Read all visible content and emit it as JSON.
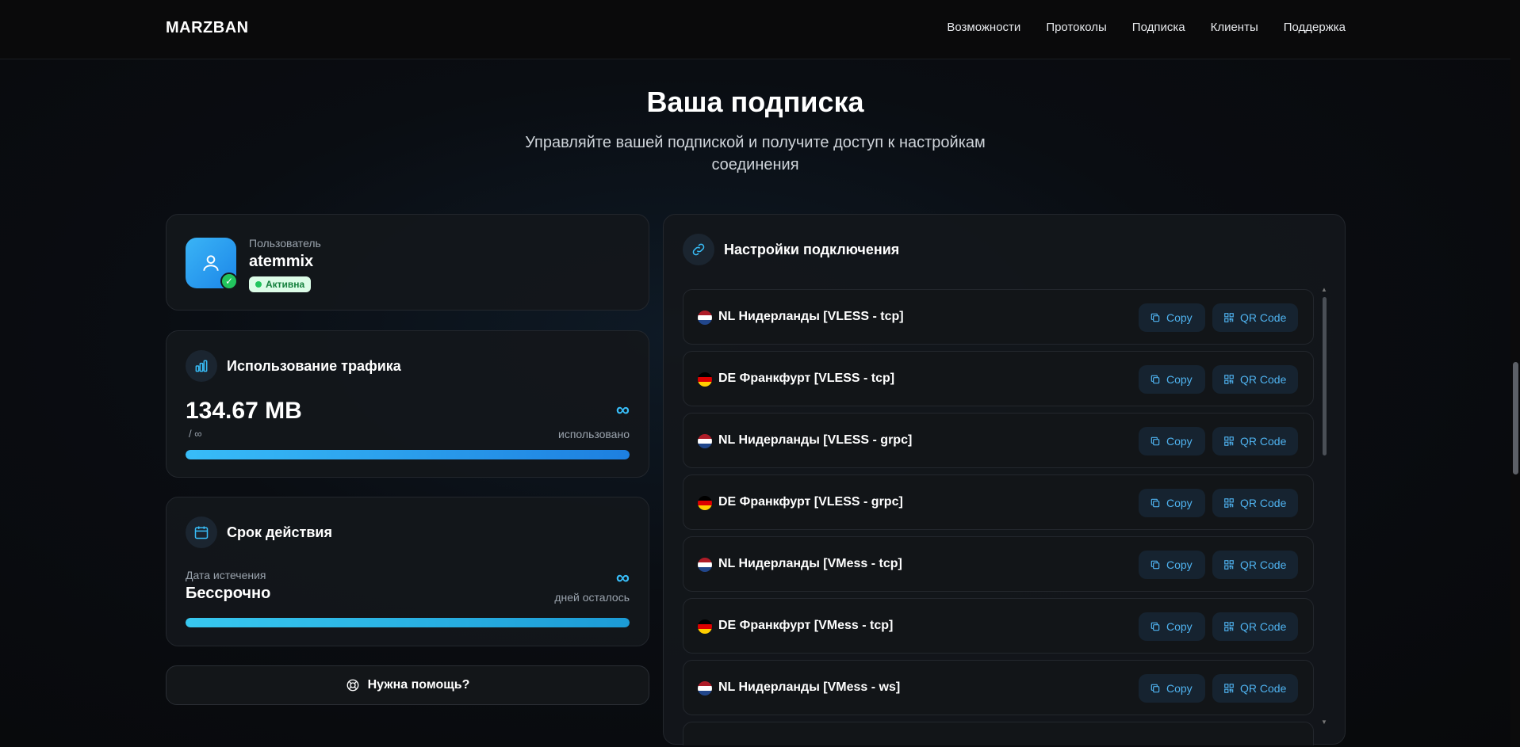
{
  "navbar": {
    "brand": "MARZBAN",
    "links": [
      "Возможности",
      "Протоколы",
      "Подписка",
      "Клиенты",
      "Поддержка"
    ]
  },
  "hero": {
    "title": "Ваша подписка",
    "subtitle_line1": "Управляйте вашей подпиской и получите доступ к настройкам",
    "subtitle_line2": "соединения"
  },
  "user": {
    "label": "Пользователь",
    "name": "atemmix",
    "status": "Активна",
    "avatar_icon": "user-icon",
    "check_icon": "check-icon"
  },
  "traffic": {
    "title": "Использование трафика",
    "icon": "bar-chart-icon",
    "used": "134.67 MB",
    "limit": "/ ∞",
    "remaining": "∞",
    "remaining_caption": "использовано",
    "progress_fraction": 1.0
  },
  "expiry": {
    "title": "Срок действия",
    "icon": "calendar-icon",
    "label": "Дата истечения",
    "value": "Бессрочно",
    "remaining": "∞",
    "remaining_caption": "дней осталось",
    "progress_fraction": 1.0
  },
  "help": {
    "label": "Нужна помощь?",
    "icon": "lifebuoy-icon"
  },
  "settings": {
    "title": "Настройки подключения",
    "icon": "link-icon",
    "copy_label": "Copy",
    "qr_label": "QR Code",
    "connections": [
      {
        "name": "NL Нидерланды [VLESS - tcp]",
        "flag": "nl"
      },
      {
        "name": "DE Франкфурт [VLESS - tcp]",
        "flag": "de"
      },
      {
        "name": "NL Нидерланды [VLESS - grpc]",
        "flag": "nl"
      },
      {
        "name": "DE Франкфурт [VLESS - grpc]",
        "flag": "de"
      },
      {
        "name": "NL Нидерланды [VMess - tcp]",
        "flag": "nl"
      },
      {
        "name": "DE Франкфурт [VMess - tcp]",
        "flag": "de"
      },
      {
        "name": "NL Нидерланды [VMess - ws]",
        "flag": "nl"
      },
      {
        "name": "",
        "flag": ""
      }
    ]
  },
  "colors": {
    "accent": "#38bdf8",
    "status_green": "#22c55e",
    "background": "#0a0d12"
  }
}
